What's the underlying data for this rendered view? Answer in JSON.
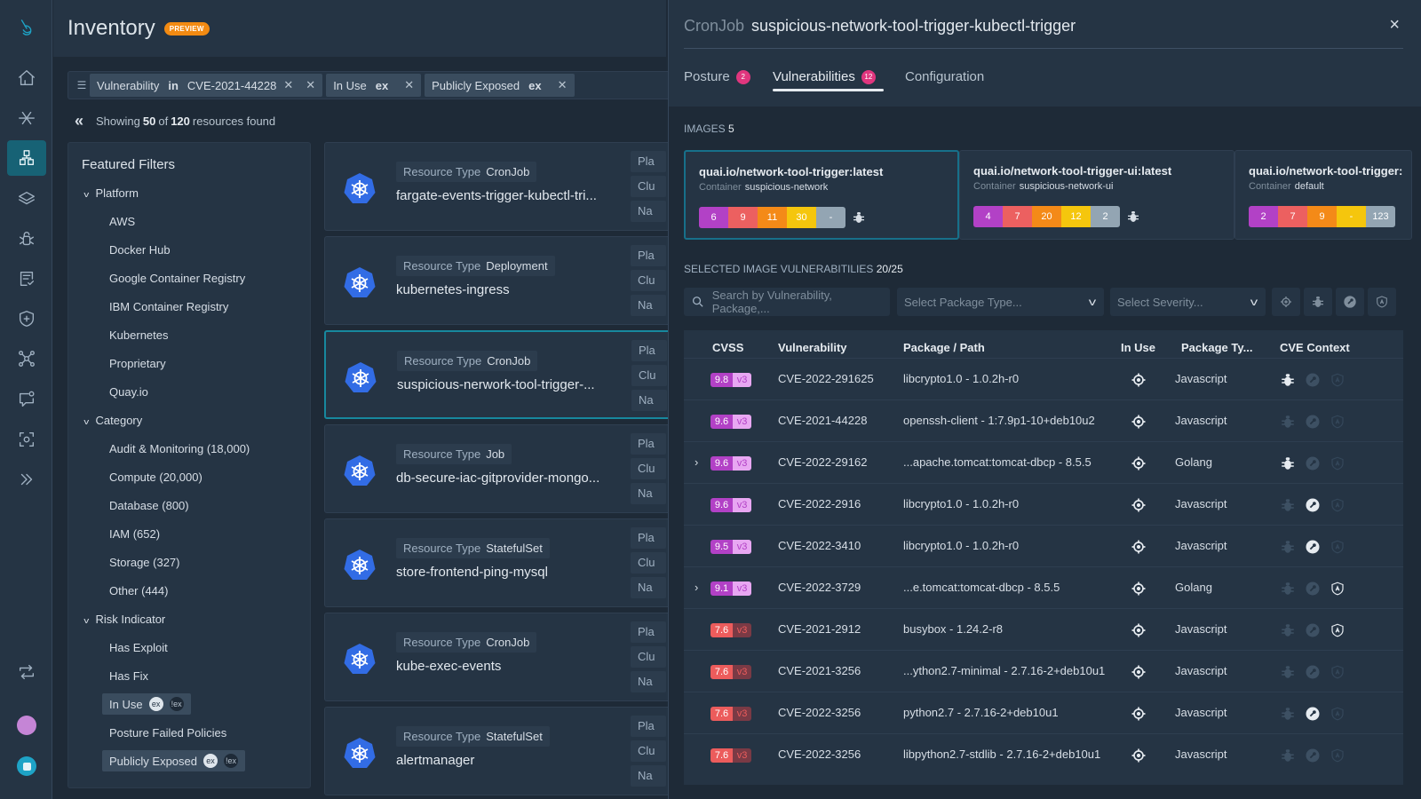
{
  "rail": {
    "items": [
      "logo-icon",
      "home-icon",
      "asterisk-icon",
      "inventory-icon",
      "layers-icon",
      "bug-icon",
      "report-icon",
      "shield-plus-icon",
      "network-icon",
      "chat-icon",
      "scan-icon",
      "expand-icon",
      "sync-icon"
    ]
  },
  "header": {
    "title": "Inventory",
    "badge": "PREVIEW"
  },
  "filters": {
    "chips": [
      {
        "field": "Vulnerability",
        "op": "in",
        "value": "CVE-2021-44228"
      },
      {
        "field": "In Use",
        "op": "",
        "value": "ex"
      },
      {
        "field": "Publicly Exposed",
        "op": "",
        "value": "ex"
      }
    ]
  },
  "summary": {
    "prefix": "Showing",
    "shown": "50",
    "mid": "of",
    "total": "120",
    "suffix": "resources found"
  },
  "featured": {
    "title": "Featured Filters",
    "groups": [
      {
        "label": "Platform",
        "items": [
          "AWS",
          "Docker Hub",
          "Google Container Registry",
          "IBM Container Registry",
          "Kubernetes",
          "Proprietary",
          "Quay.io"
        ]
      },
      {
        "label": "Category",
        "items": [
          "Audit & Monitoring (18,000)",
          "Compute (20,000)",
          "Database (800)",
          "IAM (652)",
          "Storage (327)",
          "Other (444)"
        ]
      },
      {
        "label": "Risk Indicator",
        "items": [
          "Has Exploit",
          "Has Fix",
          "In Use",
          "Posture Failed Policies",
          "Publicly Exposed"
        ]
      }
    ],
    "pill_on": "ex",
    "pill_off": "!ex"
  },
  "resources": {
    "type_label": "Resource Type",
    "side_labels": [
      "Pla",
      "Clu",
      "Na"
    ],
    "items": [
      {
        "type": "CronJob",
        "name": "fargate-events-trigger-kubectl-tri..."
      },
      {
        "type": "Deployment",
        "name": "kubernetes-ingress"
      },
      {
        "type": "CronJob",
        "name": "suspicious-nerwork-tool-trigger-..."
      },
      {
        "type": "Job",
        "name": "db-secure-iac-gitprovider-mongo..."
      },
      {
        "type": "StatefulSet",
        "name": "store-frontend-ping-mysql"
      },
      {
        "type": "CronJob",
        "name": "kube-exec-events"
      },
      {
        "type": "StatefulSet",
        "name": "alertmanager"
      }
    ]
  },
  "panel": {
    "kind": "CronJob",
    "name": "suspicious-network-tool-trigger-kubectl-trigger",
    "close": "×",
    "tabs": [
      {
        "label": "Posture",
        "badge": "2"
      },
      {
        "label": "Vulnerabilities",
        "badge": "12"
      },
      {
        "label": "Configuration",
        "badge": ""
      }
    ],
    "images_label": "IMAGES",
    "images_count": "5",
    "container_label": "Container",
    "images": [
      {
        "name": "quai.io/network-tool-trigger:latest",
        "container": "suspicious-network",
        "counts": [
          "6",
          "9",
          "11",
          "30",
          "-"
        ]
      },
      {
        "name": "quai.io/network-tool-trigger-ui:latest",
        "container": "suspicious-network-ui",
        "counts": [
          "4",
          "7",
          "20",
          "12",
          "2"
        ]
      },
      {
        "name": "quai.io/network-tool-trigger:",
        "container": "default",
        "counts": [
          "2",
          "7",
          "9",
          "-",
          "123"
        ]
      }
    ],
    "severity_colors": [
      "#b241c6",
      "#ec6060",
      "#f48a18",
      "#f5c60d",
      "#93a5b3"
    ],
    "selected_label": "SELECTED IMAGE VULNERABITILIES",
    "selected_count": "20/25",
    "search_placeholder": "Search by Vulnerability, Package,...",
    "package_type_placeholder": "Select Package Type...",
    "severity_placeholder": "Select Severity...",
    "columns": [
      "CVSS",
      "Vulnerability",
      "Package / Path",
      "In Use",
      "Package Ty...",
      "CVE Context"
    ],
    "rows": [
      {
        "score": "9.8",
        "ver": "v3",
        "sev": "crit",
        "cve": "CVE-2022-291625",
        "pkg": "libcrypto1.0 - 1.0.2h-r0",
        "type": "Javascript",
        "expand": false,
        "exploit": true,
        "fix": false,
        "attack": false
      },
      {
        "score": "9.6",
        "ver": "v3",
        "sev": "crit",
        "cve": "CVE-2021-44228",
        "pkg": "openssh-client - 1:7.9p1-10+deb10u2",
        "type": "Javascript",
        "expand": false,
        "exploit": false,
        "fix": false,
        "attack": false
      },
      {
        "score": "9.6",
        "ver": "v3",
        "sev": "crit",
        "cve": "CVE-2022-29162",
        "pkg": "...apache.tomcat:tomcat-dbcp - 8.5.5",
        "type": "Golang",
        "expand": true,
        "exploit": true,
        "fix": false,
        "attack": false
      },
      {
        "score": "9.6",
        "ver": "v3",
        "sev": "crit",
        "cve": "CVE-2022-2916",
        "pkg": "libcrypto1.0 - 1.0.2h-r0",
        "type": "Javascript",
        "expand": false,
        "exploit": false,
        "fix": true,
        "attack": false
      },
      {
        "score": "9.5",
        "ver": "v3",
        "sev": "crit",
        "cve": "CVE-2022-3410",
        "pkg": "libcrypto1.0 - 1.0.2h-r0",
        "type": "Javascript",
        "expand": false,
        "exploit": false,
        "fix": true,
        "attack": false
      },
      {
        "score": "9.1",
        "ver": "v3",
        "sev": "crit",
        "cve": "CVE-2022-3729",
        "pkg": "...e.tomcat:tomcat-dbcp - 8.5.5",
        "type": "Golang",
        "expand": true,
        "exploit": false,
        "fix": false,
        "attack": true
      },
      {
        "score": "7.6",
        "ver": "v3",
        "sev": "high",
        "cve": "CVE-2021-2912",
        "pkg": "busybox - 1.24.2-r8",
        "type": "Javascript",
        "expand": false,
        "exploit": false,
        "fix": false,
        "attack": true
      },
      {
        "score": "7.6",
        "ver": "v3",
        "sev": "high",
        "cve": "CVE-2021-3256",
        "pkg": "...ython2.7-minimal - 2.7.16-2+deb10u1",
        "type": "Javascript",
        "expand": false,
        "exploit": false,
        "fix": false,
        "attack": false
      },
      {
        "score": "7.6",
        "ver": "v3",
        "sev": "high",
        "cve": "CVE-2022-3256",
        "pkg": "python2.7 - 2.7.16-2+deb10u1",
        "type": "Javascript",
        "expand": false,
        "exploit": false,
        "fix": true,
        "attack": false
      },
      {
        "score": "7.6",
        "ver": "v3",
        "sev": "high",
        "cve": "CVE-2022-3256",
        "pkg": "libpython2.7-stdlib - 2.7.16-2+deb10u1",
        "type": "Javascript",
        "expand": false,
        "exploit": false,
        "fix": false,
        "attack": false
      }
    ]
  }
}
